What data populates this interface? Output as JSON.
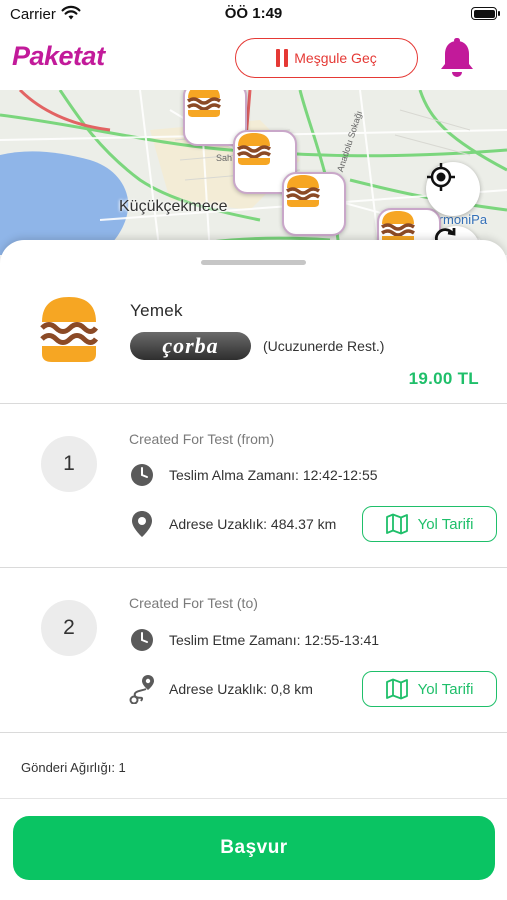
{
  "status_bar": {
    "carrier": "Carrier",
    "time": "ÖÖ 1:49"
  },
  "header": {
    "logo": "Paketat",
    "busy_button": "Meşgule Geç"
  },
  "map": {
    "place_label": "Küçükçekmece",
    "place_label_2": "ArmoniPa",
    "street_label": "Anadolu Sokağı",
    "street_label_2": "Sah"
  },
  "order": {
    "category": "Yemek",
    "brand": "çorba",
    "restaurant": "(Ucuzunerde Rest.)",
    "price": "19.00 TL"
  },
  "stops": [
    {
      "number": "1",
      "title": "Created For Test (from)",
      "time_text": "Teslim Alma Zamanı: 12:42-12:55",
      "distance_text": "Adrese Uzaklık: 484.37 km",
      "route_label": "Yol Tarifi"
    },
    {
      "number": "2",
      "title": "Created For Test (to)",
      "time_text": "Teslim Etme Zamanı: 12:55-13:41",
      "distance_text": "Adrese Uzaklık: 0,8 km",
      "route_label": "Yol Tarifi"
    }
  ],
  "weight_text": "Gönderi Ağırlığı: 1",
  "apply_button": "Başvur",
  "colors": {
    "brand": "#c21a9a",
    "accent_green": "#0ac463",
    "busy_red": "#e53935"
  },
  "icons": [
    "wifi-icon",
    "battery-icon",
    "pause-icon",
    "bell-icon",
    "burger-icon",
    "locate-icon",
    "refresh-icon",
    "clock-icon",
    "location-pin-icon",
    "route-icon",
    "map-icon"
  ]
}
